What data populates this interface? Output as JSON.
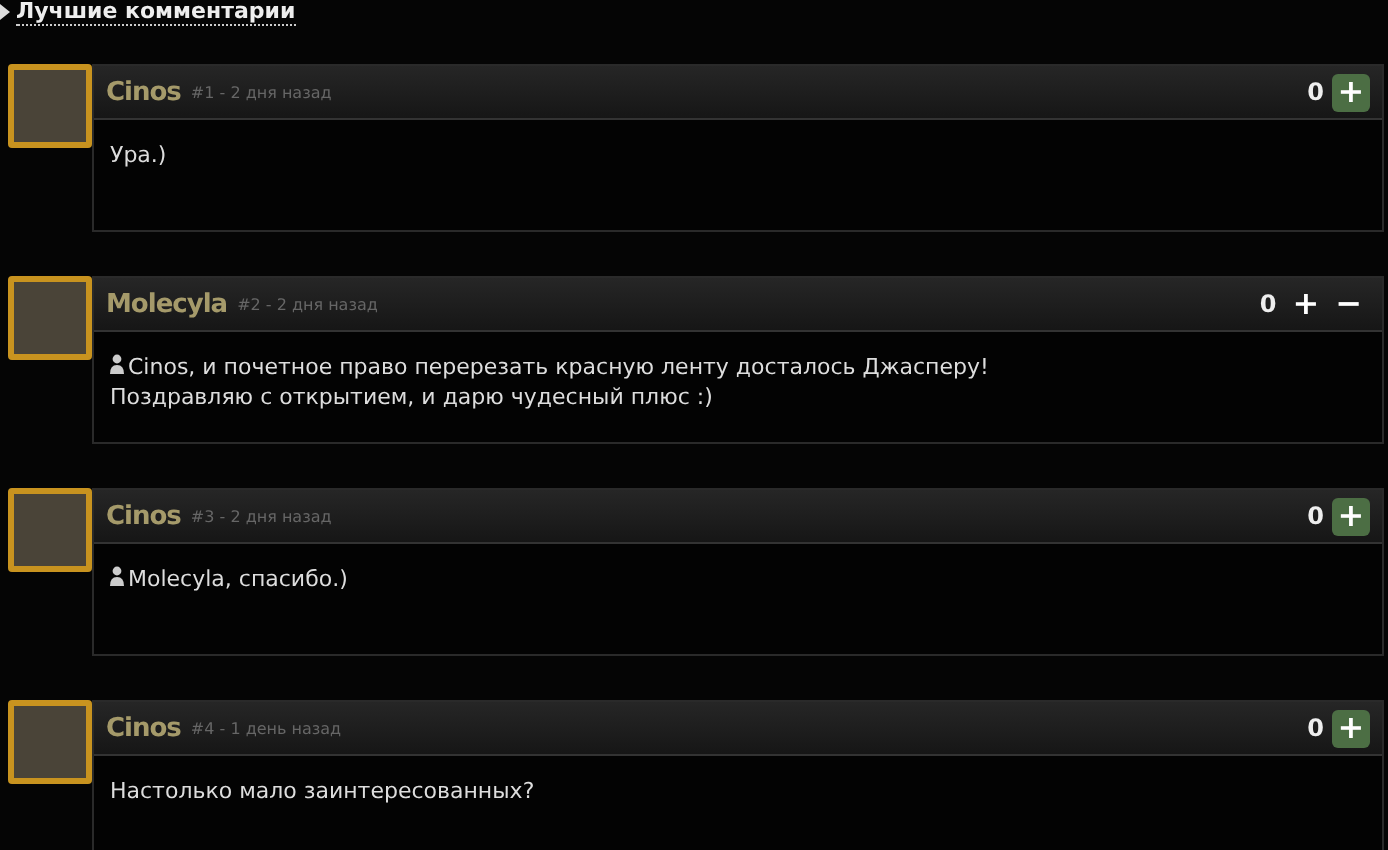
{
  "section_title": "Лучшие комментарии",
  "comments": [
    {
      "author": "Cinos",
      "meta": "#1 - 2 дня назад",
      "score": "0",
      "vote_buttons": [
        {
          "symbol": "+",
          "highlighted": true
        }
      ],
      "text": "Ура.)"
    },
    {
      "author": "Molecyla",
      "meta": "#2 - 2 дня назад",
      "score": "0",
      "vote_buttons": [
        {
          "symbol": "+",
          "highlighted": false
        },
        {
          "symbol": "−",
          "highlighted": false
        }
      ],
      "mention": "Cinos",
      "text": ", и почетное право перерезать красную ленту досталось Джасперу!\nПоздравляю с открытием, и дарю чудесный плюс :)"
    },
    {
      "author": "Cinos",
      "meta": "#3 - 2 дня назад",
      "score": "0",
      "vote_buttons": [
        {
          "symbol": "+",
          "highlighted": true
        }
      ],
      "mention": "Molecyla",
      "text": ", спасибо.)"
    },
    {
      "author": "Cinos",
      "meta": "#4 - 1 день назад",
      "score": "0",
      "vote_buttons": [
        {
          "symbol": "+",
          "highlighted": true
        }
      ],
      "text": "Настолько мало заинтересованных?"
    }
  ]
}
